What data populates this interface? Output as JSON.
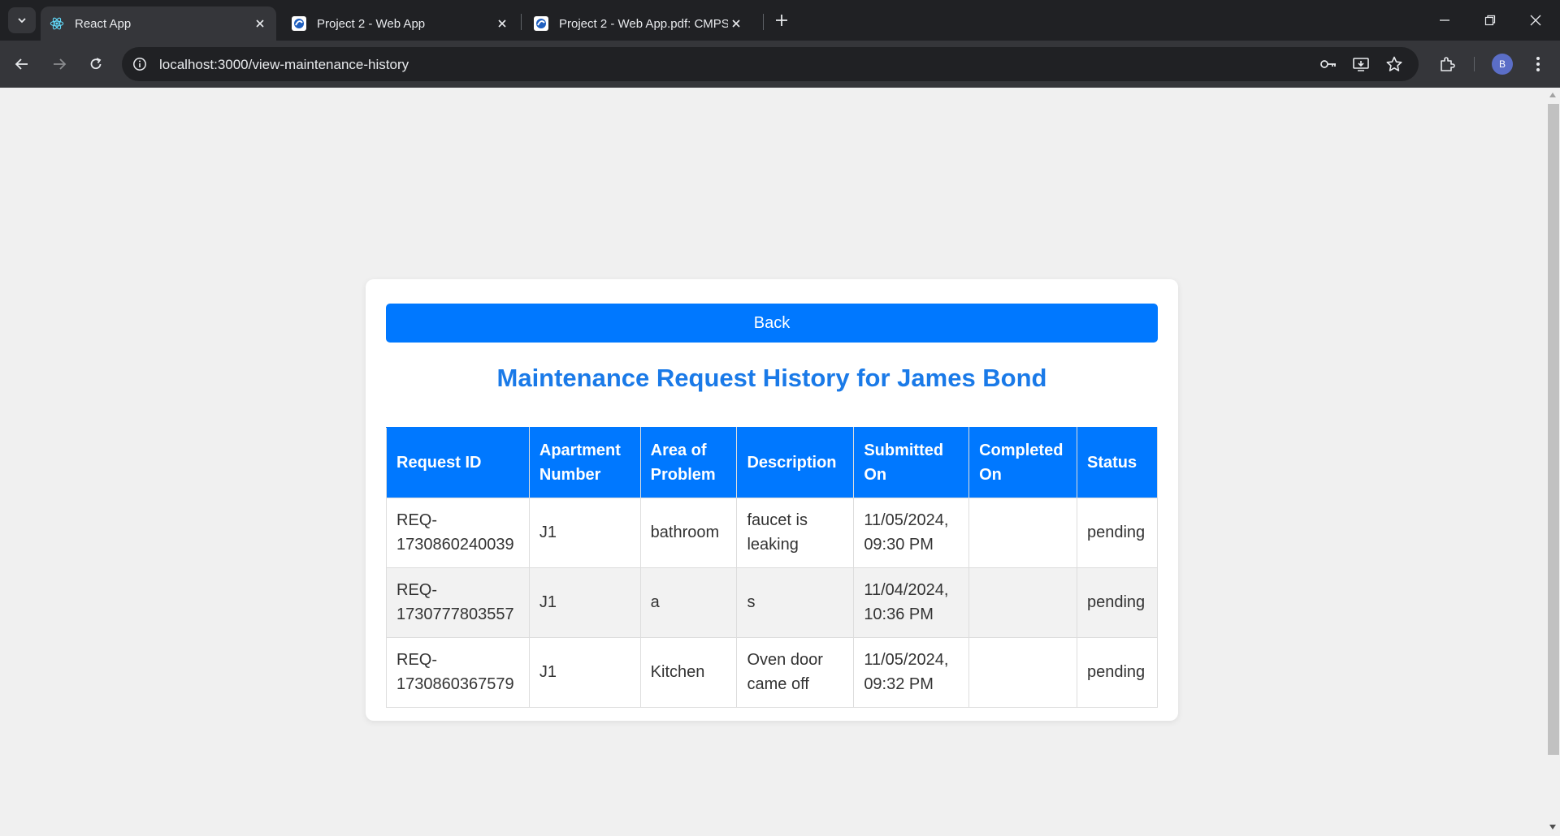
{
  "browser": {
    "tabs": [
      {
        "title": "React App",
        "active": true,
        "icon": "react-icon"
      },
      {
        "title": "Project 2 - Web App",
        "active": false,
        "icon": "edge-doc-icon"
      },
      {
        "title": "Project 2 - Web App.pdf: CMPSC",
        "active": false,
        "icon": "edge-doc-icon"
      }
    ],
    "url": "localhost:3000/view-maintenance-history",
    "profile_initial": "B"
  },
  "page": {
    "back_label": "Back",
    "title": "Maintenance Request History for James Bond",
    "table": {
      "headers": [
        "Request ID",
        "Apartment Number",
        "Area of Problem",
        "Description",
        "Submitted On",
        "Completed On",
        "Status"
      ],
      "rows": [
        {
          "request_id": "REQ-1730860240039",
          "apartment": "J1",
          "area": "bathroom",
          "description": "faucet is leaking",
          "submitted": "11/05/2024, 09:30 PM",
          "completed": "",
          "status": "pending"
        },
        {
          "request_id": "REQ-1730777803557",
          "apartment": "J1",
          "area": "a",
          "description": "s",
          "submitted": "11/04/2024, 10:36 PM",
          "completed": "",
          "status": "pending"
        },
        {
          "request_id": "REQ-1730860367579",
          "apartment": "J1",
          "area": "Kitchen",
          "description": "Oven door came off",
          "submitted": "11/05/2024, 09:32 PM",
          "completed": "",
          "status": "pending"
        }
      ]
    }
  },
  "colors": {
    "primary": "#0078ff",
    "title": "#1a7ae8"
  }
}
